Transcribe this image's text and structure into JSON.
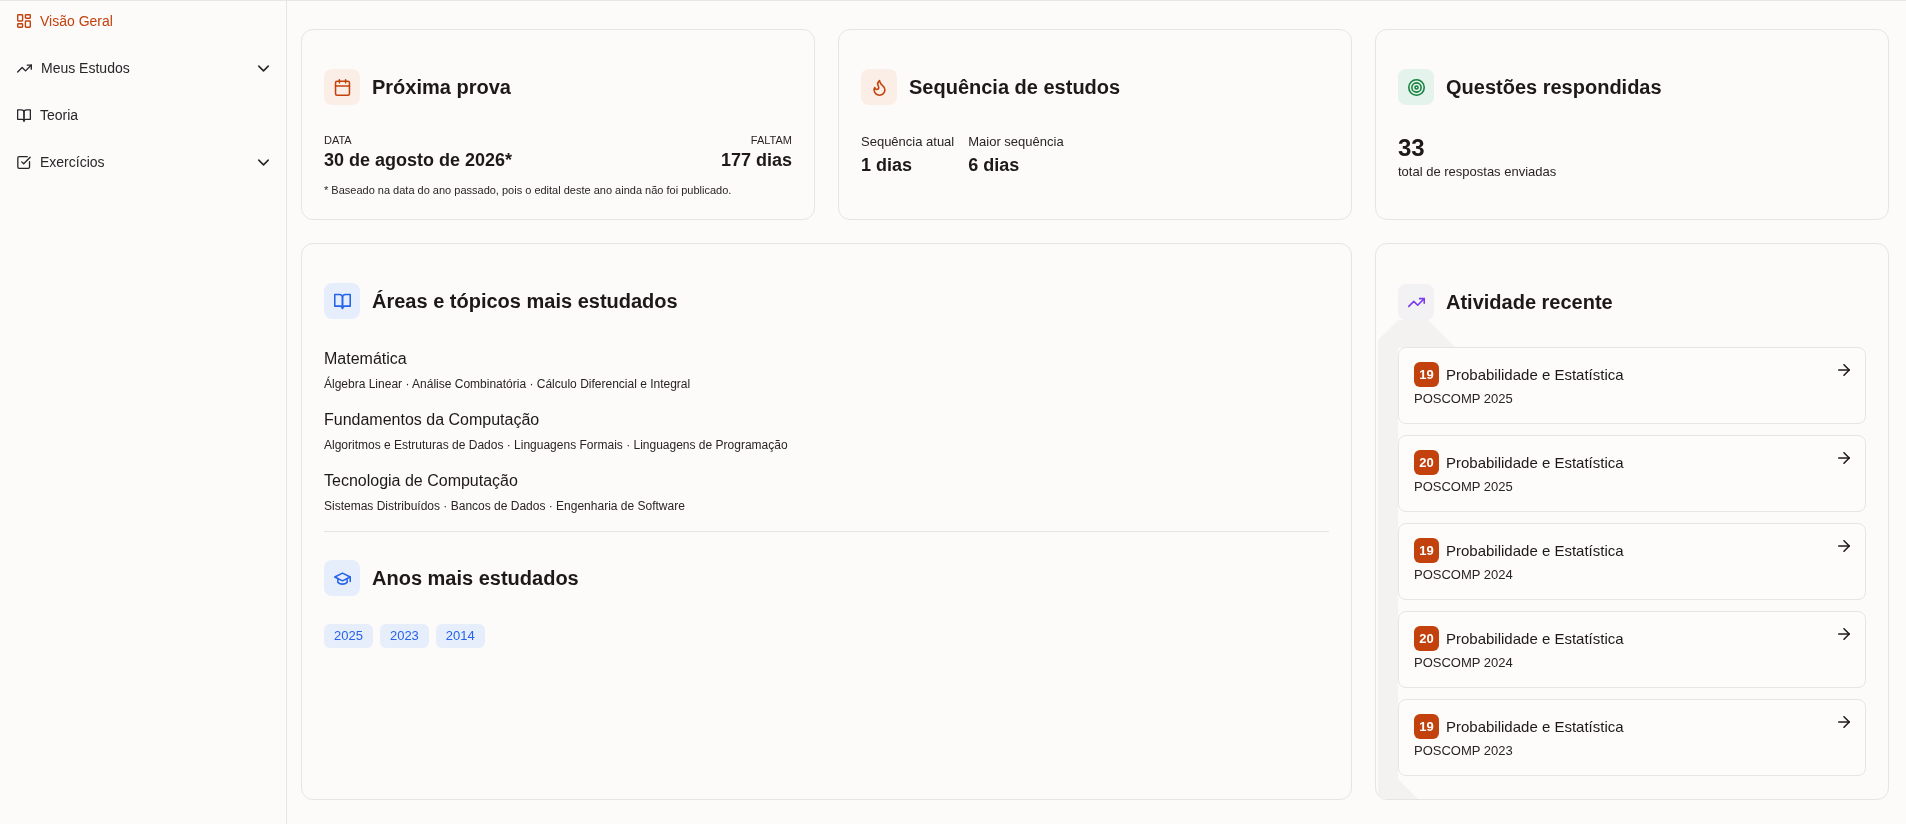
{
  "sidebar": {
    "items": [
      {
        "label": "Visão Geral",
        "selected": true,
        "kind": "link"
      },
      {
        "label": "Meus Estudos",
        "selected": false,
        "kind": "group"
      },
      {
        "label": "Teoria",
        "selected": false,
        "kind": "link"
      },
      {
        "label": "Exercícios",
        "selected": false,
        "kind": "group"
      }
    ]
  },
  "next_exam": {
    "title": "Próxima prova",
    "date_label": "DATA",
    "date": "30 de agosto de 2026*",
    "remaining_label": "FALTAM",
    "remaining": "177 dias",
    "footnote": "* Baseado na data do ano passado, pois o edital deste ano ainda não foi publicado."
  },
  "study_streak": {
    "title": "Sequência de estudos",
    "stats": [
      {
        "label": "Sequência atual",
        "value": "1 dias"
      },
      {
        "label": "Maior sequência",
        "value": "6 dias"
      }
    ]
  },
  "answered_questions": {
    "title": "Questões respondidas",
    "value": "33",
    "caption": "total de respostas enviadas"
  },
  "top_areas": {
    "title": "Áreas e tópicos mais estudados",
    "areas": [
      {
        "name": "Matemática",
        "topics": "Álgebra Linear · Análise Combinatória · Cálculo Diferencial e Integral"
      },
      {
        "name": "Fundamentos da Computação",
        "topics": "Algoritmos e Estruturas de Dados · Linguagens Formais · Linguagens de Programação"
      },
      {
        "name": "Tecnologia de Computação",
        "topics": "Sistemas Distribuídos · Bancos de Dados · Engenharia de Software"
      }
    ]
  },
  "top_years": {
    "title": "Anos mais estudados",
    "years": [
      "2025",
      "2023",
      "2014"
    ]
  },
  "recent_activity": {
    "title": "Atividade recente",
    "items": [
      {
        "number": "19",
        "subject": "Probabilidade e Estatística",
        "exam": "POSCOMP 2025"
      },
      {
        "number": "20",
        "subject": "Probabilidade e Estatística",
        "exam": "POSCOMP 2025"
      },
      {
        "number": "19",
        "subject": "Probabilidade e Estatística",
        "exam": "POSCOMP 2024"
      },
      {
        "number": "20",
        "subject": "Probabilidade e Estatística",
        "exam": "POSCOMP 2024"
      },
      {
        "number": "19",
        "subject": "Probabilidade e Estatística",
        "exam": "POSCOMP 2023"
      }
    ]
  }
}
